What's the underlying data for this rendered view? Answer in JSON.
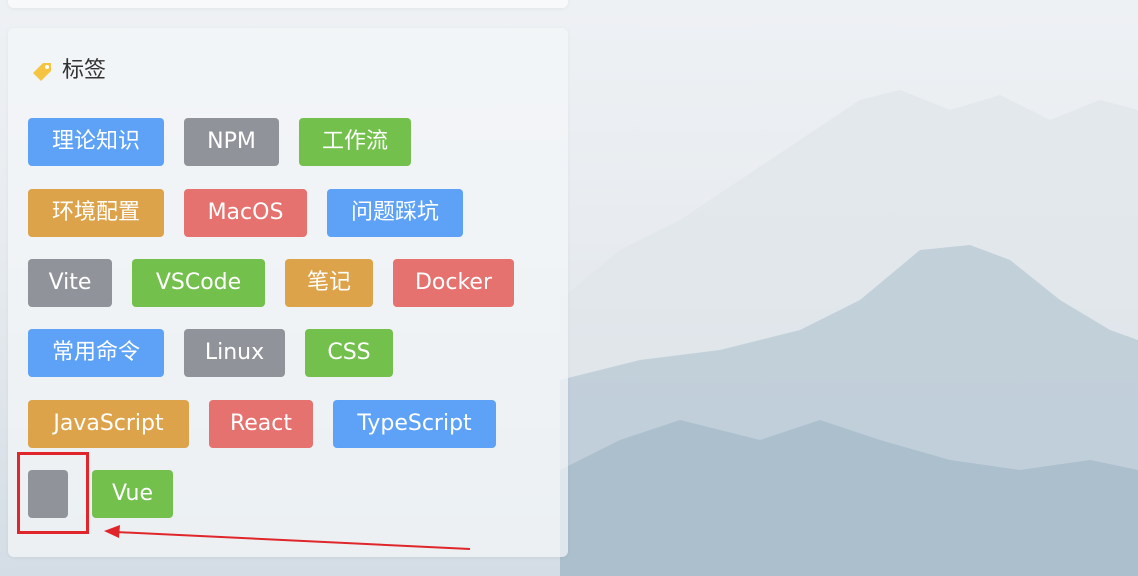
{
  "card": {
    "title": "标签",
    "icon": "tag-icon"
  },
  "tags": [
    {
      "label": "理论知识",
      "color": "#5ea2f7"
    },
    {
      "label": "NPM",
      "color": "#909399"
    },
    {
      "label": "工作流",
      "color": "#73c04d"
    },
    {
      "label": "环境配置",
      "color": "#dda34a"
    },
    {
      "label": "MacOS",
      "color": "#e5726e"
    },
    {
      "label": "问题踩坑",
      "color": "#5ea2f7"
    },
    {
      "label": "Vite",
      "color": "#909399"
    },
    {
      "label": "VSCode",
      "color": "#73c04d"
    },
    {
      "label": "笔记",
      "color": "#dda34a"
    },
    {
      "label": "Docker",
      "color": "#e5726e"
    },
    {
      "label": "常用命令",
      "color": "#5ea2f7"
    },
    {
      "label": "Linux",
      "color": "#909399"
    },
    {
      "label": "CSS",
      "color": "#73c04d"
    },
    {
      "label": "JavaScript",
      "color": "#dda34a"
    },
    {
      "label": "React",
      "color": "#e5726e"
    },
    {
      "label": "TypeScript",
      "color": "#5ea2f7"
    },
    {
      "label": "",
      "color": "#909399"
    },
    {
      "label": "Vue",
      "color": "#73c04d"
    }
  ],
  "annotation": {
    "highlight_color": "#e0262a"
  }
}
